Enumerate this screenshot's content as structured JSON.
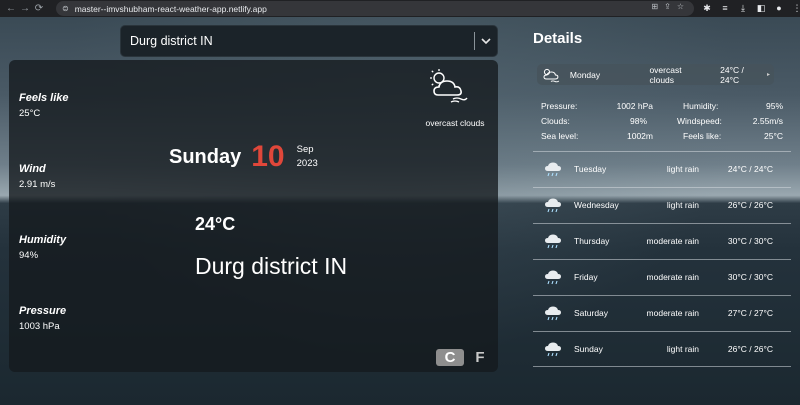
{
  "browser": {
    "url": "master--imvshubham-react-weather-app.netlify.app"
  },
  "search": {
    "value": "Durg district IN"
  },
  "current": {
    "stats": [
      {
        "label": "Feels like",
        "value": "25°C"
      },
      {
        "label": "Wind",
        "value": "2.91 m/s"
      },
      {
        "label": "Humidity",
        "value": "94%"
      },
      {
        "label": "Pressure",
        "value": "1003 hPa"
      }
    ],
    "day_name": "Sunday",
    "day_number": "10",
    "month": "Sep",
    "year": "2023",
    "temperature": "24°C",
    "city": "Durg district IN",
    "condition": "overcast clouds",
    "unit_c": "C",
    "unit_f": "F"
  },
  "details": {
    "title": "Details",
    "today": {
      "day": "Monday",
      "condition": "overcast clouds",
      "temp": "24°C / 24°C"
    },
    "metrics": [
      {
        "k1": "Pressure:",
        "v1": "1002 hPa",
        "k2": "Humidity:",
        "v2": "95%"
      },
      {
        "k1": "Clouds:",
        "v1": "98%",
        "k2": "Windspeed:",
        "v2": "2.55m/s"
      },
      {
        "k1": "Sea level:",
        "v1": "1002m",
        "k2": "Feels like:",
        "v2": "25°C"
      }
    ],
    "forecast": [
      {
        "day": "Tuesday",
        "condition": "light rain",
        "temp": "24°C / 24°C"
      },
      {
        "day": "Wednesday",
        "condition": "light rain",
        "temp": "26°C / 26°C"
      },
      {
        "day": "Thursday",
        "condition": "moderate rain",
        "temp": "30°C / 30°C"
      },
      {
        "day": "Friday",
        "condition": "moderate rain",
        "temp": "30°C / 30°C"
      },
      {
        "day": "Saturday",
        "condition": "moderate rain",
        "temp": "27°C / 27°C"
      },
      {
        "day": "Sunday",
        "condition": "light rain",
        "temp": "26°C / 26°C"
      }
    ]
  }
}
